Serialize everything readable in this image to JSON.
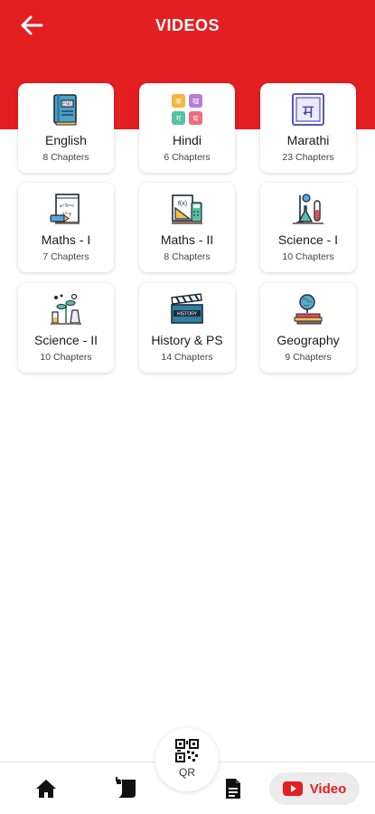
{
  "header": {
    "title": "VIDEOS",
    "back_icon": "arrow-left-icon",
    "color": "#e41f22"
  },
  "subjects": [
    {
      "name": "English",
      "chapters": "8 Chapters",
      "icon": "english-book-icon"
    },
    {
      "name": "Hindi",
      "chapters": "6 Chapters",
      "icon": "hindi-letters-icon"
    },
    {
      "name": "Marathi",
      "chapters": "23 Chapters",
      "icon": "marathi-letter-icon"
    },
    {
      "name": "Maths - I",
      "chapters": "7 Chapters",
      "icon": "maths-notes-icon"
    },
    {
      "name": "Maths - II",
      "chapters": "8 Chapters",
      "icon": "geometry-tools-icon"
    },
    {
      "name": "Science - I",
      "chapters": "10 Chapters",
      "icon": "lab-flask-icon"
    },
    {
      "name": "Science - II",
      "chapters": "10 Chapters",
      "icon": "biology-plant-icon"
    },
    {
      "name": "History & PS",
      "chapters": "14 Chapters",
      "icon": "history-clapperboard-icon"
    },
    {
      "name": "Geography",
      "chapters": "9 Chapters",
      "icon": "globe-books-icon"
    }
  ],
  "bottom_nav": {
    "home_icon": "home-icon",
    "scroll_icon": "scroll-icon",
    "qr_label": "QR",
    "doc_icon": "document-icon",
    "video_label": "Video",
    "video_icon": "youtube-icon",
    "accent": "#e41f22"
  }
}
